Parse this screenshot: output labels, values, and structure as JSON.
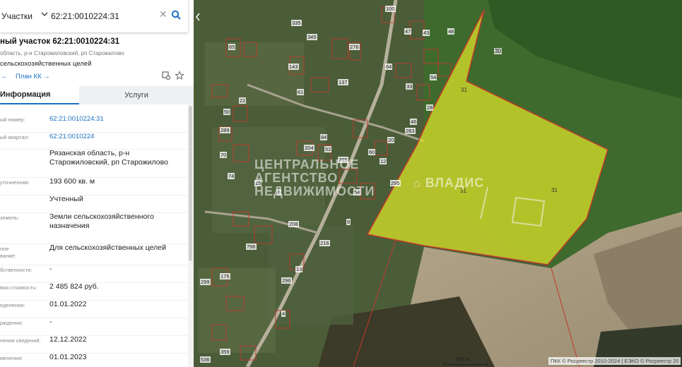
{
  "search": {
    "type_label": "Участки",
    "value": "62:21:0010224:31"
  },
  "parcel": {
    "title": "ный участок 62:21:0010224:31",
    "address": "область, р-н Старожиловский, рп Старожилово",
    "use": "сельскохозяйственных целей",
    "link_cadmap": "→",
    "link_plan": "План КК →"
  },
  "tabs": {
    "info": "Информация",
    "services": "Услуги"
  },
  "rows": [
    {
      "key": "ый номер:",
      "value": "62:21:0010224:31",
      "link": true
    },
    {
      "key": "ый квартал:",
      "value": "62:21:0010224",
      "link": true
    },
    {
      "key": "",
      "value": "Рязанская область, р-н Старожиловский, рп Старожилово",
      "link": false
    },
    {
      "key": "уточненная:",
      "value": "193 600 кв. м",
      "link": false
    },
    {
      "key": "",
      "value": "Учтенный",
      "link": false
    },
    {
      "key": "земель:",
      "value": "Земли сельскохозяйственного назначения",
      "link": false
    },
    {
      "key": "ное\nвание:",
      "value": "Для сельскохозяйственных целей",
      "link": false
    },
    {
      "key": "бственности:",
      "value": "-",
      "link": false
    },
    {
      "key": "вая стоимость:",
      "value": "2 485 824 руб.",
      "link": false
    },
    {
      "key": "еделения:",
      "value": "01.01.2022",
      "link": false
    },
    {
      "key": "рждения:",
      "value": "-",
      "link": false
    },
    {
      "key": "нения сведений:",
      "value": "12.12.2022",
      "link": false
    },
    {
      "key": "менения:",
      "value": "01.01.2023",
      "link": false
    }
  ],
  "map": {
    "watermark_left": "ЦЕНТРАЛЬНОЕ\nАГЕНТСТВО\nНЕДВИЖИМОСТИ",
    "watermark_right": "ВЛАДИС",
    "parcel_labels": [
      "31",
      "31",
      "31",
      "30"
    ],
    "plot_numbers": [
      "65",
      "276",
      "137",
      "143",
      "61",
      "84",
      "22",
      "50",
      "289",
      "70",
      "74",
      "204",
      "52",
      "60",
      "795",
      "54",
      "20",
      "46",
      "283",
      "295",
      "296",
      "796",
      "216",
      "175",
      "299",
      "359",
      "536",
      "100",
      "335",
      "345",
      "43",
      "33",
      "12",
      "4",
      "208",
      "9",
      "47",
      "48",
      "54",
      "64",
      "28",
      "15",
      "6",
      "13"
    ],
    "scale_label": "100 м",
    "copyright": "ПКК © Росреестр 2010-2024 | ЕЭКО © Росреестр 20",
    "colors": {
      "parcel_fill": "#d9e22a",
      "parcel_stroke": "#c43a2a",
      "boundary": "#c0392b"
    }
  }
}
